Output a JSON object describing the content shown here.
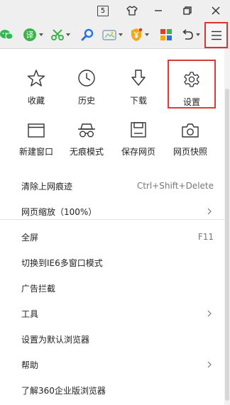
{
  "titlebar": {
    "tab_count": "5"
  },
  "colors": {
    "highlight_border": "#d93a3a",
    "wechat_green": "#2fb94c",
    "translate_green": "#3cb34a",
    "search_blue": "#2b73d8"
  },
  "toolbar": {
    "icons": [
      "wechat-icon",
      "translate-icon",
      "scissors-icon",
      "search-icon",
      "gamepad-icon",
      "yen-shield-icon",
      "apps-grid-icon",
      "undo-icon",
      "menu-icon"
    ]
  },
  "menu": {
    "tiles_row1": [
      {
        "label": "收藏",
        "icon": "star-icon"
      },
      {
        "label": "历史",
        "icon": "clock-icon"
      },
      {
        "label": "下载",
        "icon": "download-arrow-icon"
      },
      {
        "label": "设置",
        "icon": "gear-icon",
        "highlighted": true
      }
    ],
    "tiles_row2": [
      {
        "label": "新建窗口",
        "icon": "new-window-icon"
      },
      {
        "label": "无痕模式",
        "icon": "incognito-icon"
      },
      {
        "label": "保存网页",
        "icon": "save-page-icon"
      },
      {
        "label": "网页快照",
        "icon": "camera-icon"
      }
    ],
    "items": [
      {
        "label": "清除上网痕迹",
        "shortcut": "Ctrl+Shift+Delete",
        "submenu": false
      },
      {
        "label": "网页缩放（100%）",
        "shortcut": "",
        "submenu": true
      },
      {
        "label": "全屏",
        "shortcut": "F11",
        "submenu": false
      },
      {
        "label": "切换到IE6多窗口模式",
        "shortcut": "",
        "submenu": false
      },
      {
        "label": "广告拦截",
        "shortcut": "",
        "submenu": false
      },
      {
        "label": "工具",
        "shortcut": "",
        "submenu": true
      },
      {
        "label": "设置为默认浏览器",
        "shortcut": "",
        "submenu": false
      },
      {
        "label": "帮助",
        "shortcut": "",
        "submenu": true
      },
      {
        "label": "了解360企业版浏览器",
        "shortcut": "",
        "submenu": false
      }
    ]
  }
}
